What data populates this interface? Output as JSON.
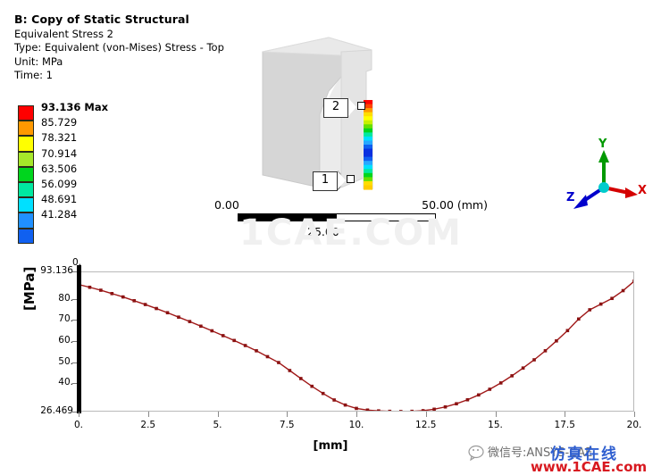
{
  "result_header": {
    "title": "B: Copy of Static Structural",
    "subtitle": "Equivalent Stress 2",
    "type_line": "Type: Equivalent (von-Mises) Stress - Top",
    "unit_line": "Unit: MPa",
    "time_line": "Time: 1"
  },
  "legend": {
    "name": "stress-color-legend",
    "entries": [
      {
        "label": "93.136 Max",
        "color": "#ff0000",
        "is_max": true
      },
      {
        "label": "85.729",
        "color": "#ff9900"
      },
      {
        "label": "78.321",
        "color": "#ffff00"
      },
      {
        "label": "70.914",
        "color": "#a6e82a"
      },
      {
        "label": "63.506",
        "color": "#00d51e"
      },
      {
        "label": "56.099",
        "color": "#00e8a0"
      },
      {
        "label": "48.691",
        "color": "#00e0ff"
      },
      {
        "label": "41.284",
        "color": "#2090ff"
      },
      {
        "label": "",
        "color": "#1060f0"
      }
    ]
  },
  "model": {
    "callouts": [
      {
        "id": "2",
        "label": "2"
      },
      {
        "id": "1",
        "label": "1"
      }
    ],
    "path_colors": [
      "#ff0000",
      "#ff4400",
      "#ff9900",
      "#ffdd00",
      "#ffff00",
      "#c8f000",
      "#66e000",
      "#00d51e",
      "#00e8a0",
      "#00e0ff",
      "#28a8ff",
      "#1060f0",
      "#0a30e0",
      "#0a30e0",
      "#1060f0",
      "#28a8ff",
      "#00e0ff",
      "#00e8a0",
      "#00d51e",
      "#66e000",
      "#ffdd00",
      "#ffcc00"
    ]
  },
  "scale_bar": {
    "left": "0.00",
    "mid": "25.00",
    "right": "50.00 (mm)"
  },
  "axis_triad": {
    "x_label": "X",
    "y_label": "Y",
    "z_label": "Z",
    "x_color": "#d40000",
    "y_color": "#009900",
    "z_color": "#0000cc",
    "origin_color": "#00cccc"
  },
  "watermarks": {
    "center": "1CAE.COM",
    "wechat_prefix": "微信号:ANSYS-CAE",
    "wechat_brand": "仿真在线",
    "site": "www.1CAE.com"
  },
  "chart_data": {
    "type": "line",
    "title": "",
    "xlabel": "[mm]",
    "ylabel": "[MPa]",
    "xlim": [
      0,
      20
    ],
    "ylim": [
      26.469,
      93.136
    ],
    "grid": true,
    "legend": "none",
    "line_color": "#a01818",
    "marker_color": "#8b1212",
    "top_left_tick": "0.",
    "xticks": [
      0,
      2.5,
      5,
      7.5,
      10,
      12.5,
      15,
      17.5,
      20
    ],
    "xtick_labels": [
      "0.",
      "2.5",
      "5.",
      "7.5",
      "10.",
      "12.5",
      "15.",
      "17.5",
      "20."
    ],
    "yticks": [
      26.469,
      40,
      50,
      60,
      70,
      80,
      93.136
    ],
    "ytick_labels": [
      "26.469",
      "40.",
      "50.",
      "60.",
      "70.",
      "80.",
      "93.136"
    ],
    "series": [
      {
        "name": "Equivalent Stress 2",
        "x": [
          0.0,
          0.4,
          0.8,
          1.2,
          1.6,
          2.0,
          2.4,
          2.8,
          3.2,
          3.6,
          4.0,
          4.4,
          4.8,
          5.2,
          5.6,
          6.0,
          6.4,
          6.8,
          7.2,
          7.6,
          8.0,
          8.4,
          8.8,
          9.2,
          9.6,
          10.0,
          10.4,
          10.8,
          11.2,
          11.6,
          12.0,
          12.4,
          12.8,
          13.2,
          13.6,
          14.0,
          14.4,
          14.8,
          15.2,
          15.6,
          16.0,
          16.4,
          16.8,
          17.2,
          17.6,
          18.0,
          18.4,
          18.8,
          19.2,
          19.6,
          20.0
        ],
        "y": [
          86.9,
          85.6,
          84.2,
          82.6,
          81.0,
          79.2,
          77.4,
          75.5,
          73.5,
          71.4,
          69.3,
          67.1,
          64.9,
          62.6,
          60.3,
          57.9,
          55.4,
          52.6,
          49.8,
          46.0,
          42.2,
          38.5,
          35.1,
          32.0,
          29.6,
          28.0,
          27.2,
          26.8,
          26.6,
          26.5,
          26.6,
          26.9,
          27.6,
          28.7,
          30.2,
          32.1,
          34.4,
          37.1,
          40.1,
          43.5,
          47.2,
          51.1,
          55.4,
          60.1,
          65.0,
          70.5,
          74.9,
          77.6,
          80.3,
          84.0,
          88.5,
          93.136
        ]
      }
    ]
  }
}
